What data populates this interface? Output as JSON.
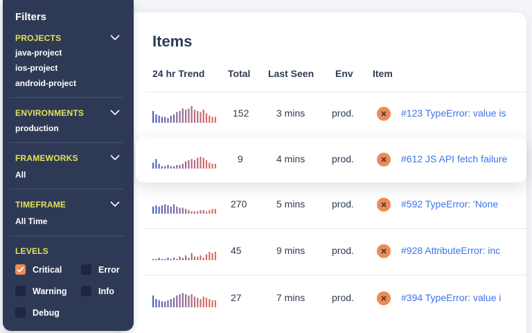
{
  "filters": {
    "title": "Filters",
    "projects": {
      "label": "PROJECTS",
      "options": [
        "java-project",
        "ios-project",
        "android-project"
      ]
    },
    "environments": {
      "label": "ENVIRONMENTS",
      "value": "production"
    },
    "frameworks": {
      "label": "FRAMEWORKS",
      "value": "All"
    },
    "timeframe": {
      "label": "TIMEFRAME",
      "value": "All Time"
    },
    "levels": {
      "label": "LEVELS",
      "items": [
        {
          "label": "Critical",
          "checked": true
        },
        {
          "label": "Error",
          "checked": false
        },
        {
          "label": "Warning",
          "checked": false
        },
        {
          "label": "Info",
          "checked": false
        },
        {
          "label": "Debug",
          "checked": false
        }
      ]
    }
  },
  "items": {
    "title": "Items",
    "columns": [
      "24 hr Trend",
      "Total",
      "Last Seen",
      "Env",
      "Item"
    ],
    "rows": [
      {
        "total": "152",
        "last_seen": "3 mins",
        "env": "prod.",
        "item": "#123 TypeError: value is",
        "trend": [
          10,
          7,
          6,
          5,
          5,
          4,
          6,
          7,
          9,
          10,
          12,
          11,
          12,
          14,
          11,
          10,
          9,
          11,
          8,
          6,
          5,
          5
        ]
      },
      {
        "total": "9",
        "last_seen": "4 mins",
        "env": "prod.",
        "item": "#612 JS API fetch failure",
        "trend": [
          5,
          8,
          4,
          2,
          2,
          3,
          2,
          2,
          3,
          3,
          4,
          6,
          7,
          8,
          7,
          9,
          10,
          9,
          7,
          5,
          4,
          4
        ]
      },
      {
        "total": "270",
        "last_seen": "5 mins",
        "env": "prod.",
        "item": "#592 TypeError:  'None",
        "trend": [
          6,
          7,
          6,
          7,
          8,
          7,
          6,
          8,
          6,
          5,
          5,
          4,
          3,
          2,
          2,
          2,
          3,
          3,
          2,
          3,
          4,
          4
        ]
      },
      {
        "total": "45",
        "last_seen": "9 mins",
        "env": "prod.",
        "item": "#928 AttributeError: inc",
        "trend": [
          1,
          1,
          2,
          1,
          1,
          2,
          1,
          2,
          1,
          3,
          2,
          4,
          2,
          6,
          3,
          3,
          4,
          2,
          5,
          7,
          6,
          7
        ]
      },
      {
        "total": "27",
        "last_seen": "7 mins",
        "env": "prod.",
        "item": "#394 TypeError: value i",
        "trend": [
          10,
          7,
          6,
          5,
          5,
          6,
          7,
          8,
          10,
          11,
          12,
          11,
          10,
          11,
          9,
          8,
          7,
          9,
          8,
          7,
          6,
          6
        ]
      }
    ]
  },
  "colors": {
    "sidebar": "#2e3a55",
    "section_label": "#e3e35a",
    "accent": "#f08a54",
    "link": "#3b73ea"
  }
}
